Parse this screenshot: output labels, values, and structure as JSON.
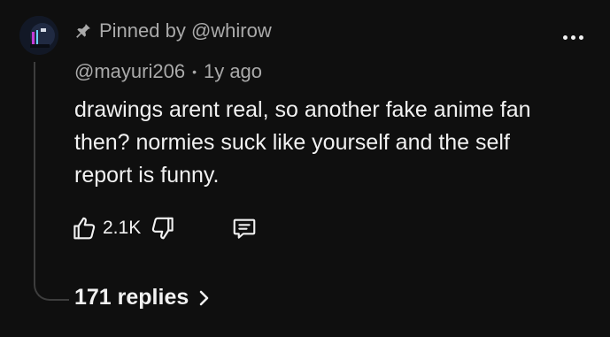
{
  "comment": {
    "pinned_label": "Pinned by @whirow",
    "author": "@mayuri206",
    "separator": "•",
    "time_ago": "1y ago",
    "text": "drawings arent real, so another fake anime fan then? normies suck like yourself and the self report is funny.",
    "like_count": "2.1K",
    "replies_label": "171 replies"
  },
  "icons": {
    "pin": "pin-icon",
    "more": "more-vertical-icon",
    "like": "thumbs-up-icon",
    "dislike": "thumbs-down-icon",
    "reply": "comment-icon",
    "chevron": "chevron-right-icon"
  },
  "colors": {
    "background": "#0f0f0f",
    "primary_text": "#f1f1f1",
    "secondary_text": "#aaaaaa",
    "thread_line": "#3d3d3d"
  }
}
